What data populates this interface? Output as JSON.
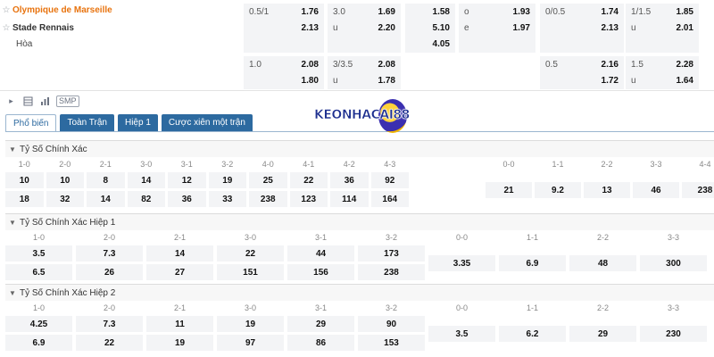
{
  "match": {
    "home": "Olympique de Marseille",
    "away": "Stade Rennais",
    "draw": "Hòa"
  },
  "top_odds": {
    "row1": [
      {
        "label": "0.5/1",
        "value": "1.76"
      },
      {
        "label": "3.0",
        "value": "1.69"
      },
      {
        "label": "",
        "value": "1.58"
      },
      {
        "label": "o",
        "value": "1.93"
      },
      {
        "label": "0/0.5",
        "value": "1.74"
      },
      {
        "label": "1/1.5",
        "value": "1.85"
      }
    ],
    "row2": [
      {
        "label": "",
        "value": "2.13"
      },
      {
        "label": "u",
        "value": "2.20"
      },
      {
        "label": "",
        "value": "5.10"
      },
      {
        "label": "e",
        "value": "1.97"
      },
      {
        "label": "",
        "value": "2.13"
      },
      {
        "label": "u",
        "value": "2.01"
      }
    ],
    "row3": [
      {
        "label": "",
        "value": ""
      },
      {
        "label": "",
        "value": ""
      },
      {
        "label": "",
        "value": "4.05"
      },
      {
        "label": "",
        "value": ""
      },
      {
        "label": "",
        "value": ""
      },
      {
        "label": "",
        "value": ""
      }
    ],
    "row4": [
      {
        "label": "1.0",
        "value": "2.08"
      },
      {
        "label": "3/3.5",
        "value": "2.08"
      },
      {
        "label": "0.5",
        "value": "2.16"
      },
      {
        "label": "1.5",
        "value": "2.28"
      }
    ],
    "row5": [
      {
        "label": "",
        "value": "1.80"
      },
      {
        "label": "u",
        "value": "1.78"
      },
      {
        "label": "",
        "value": "1.72"
      },
      {
        "label": "u",
        "value": "1.64"
      }
    ]
  },
  "toolbar": {
    "play_icon": "play-icon",
    "table_icon": "table-icon",
    "chart_icon": "bar-chart-icon",
    "smp_label": "SMP"
  },
  "tabs": [
    {
      "label": "Phổ biến",
      "active": true
    },
    {
      "label": "Toàn Trận",
      "active": false
    },
    {
      "label": "Hiệp 1",
      "active": false
    },
    {
      "label": "Cược xiên một trận",
      "active": false
    }
  ],
  "logo": {
    "text": "KEONHACAI88"
  },
  "sections": [
    {
      "title": "Tỷ Số Chính Xác",
      "headers": [
        "1-0",
        "2-0",
        "2-1",
        "3-0",
        "3-1",
        "3-2",
        "4-0",
        "4-1",
        "4-2",
        "4-3",
        "0-0",
        "1-1",
        "2-2",
        "3-3",
        "4-4"
      ],
      "home": [
        "10",
        "10",
        "8",
        "14",
        "12",
        "19",
        "25",
        "22",
        "36",
        "92"
      ],
      "away": [
        "18",
        "32",
        "14",
        "82",
        "36",
        "33",
        "238",
        "123",
        "114",
        "164"
      ],
      "draw": [
        "21",
        "9.2",
        "13",
        "46",
        "238"
      ]
    },
    {
      "title": "Tỷ Số Chính Xác Hiệp 1",
      "headers": [
        "1-0",
        "2-0",
        "2-1",
        "3-0",
        "3-1",
        "3-2",
        "0-0",
        "1-1",
        "2-2",
        "3-3"
      ],
      "home": [
        "3.5",
        "7.3",
        "14",
        "22",
        "44",
        "173"
      ],
      "away": [
        "6.5",
        "26",
        "27",
        "151",
        "156",
        "238"
      ],
      "draw": [
        "3.35",
        "6.9",
        "48",
        "300"
      ]
    },
    {
      "title": "Tỷ Số Chính Xác Hiệp 2",
      "headers": [
        "1-0",
        "2-0",
        "2-1",
        "3-0",
        "3-1",
        "3-2",
        "0-0",
        "1-1",
        "2-2",
        "3-3"
      ],
      "home": [
        "4.25",
        "7.3",
        "11",
        "19",
        "29",
        "90"
      ],
      "away": [
        "6.9",
        "22",
        "19",
        "97",
        "86",
        "153"
      ],
      "draw": [
        "3.5",
        "6.2",
        "29",
        "230"
      ]
    }
  ],
  "colors": {
    "home_team": "#e8730e",
    "tab_blue": "#2d6aa0"
  }
}
